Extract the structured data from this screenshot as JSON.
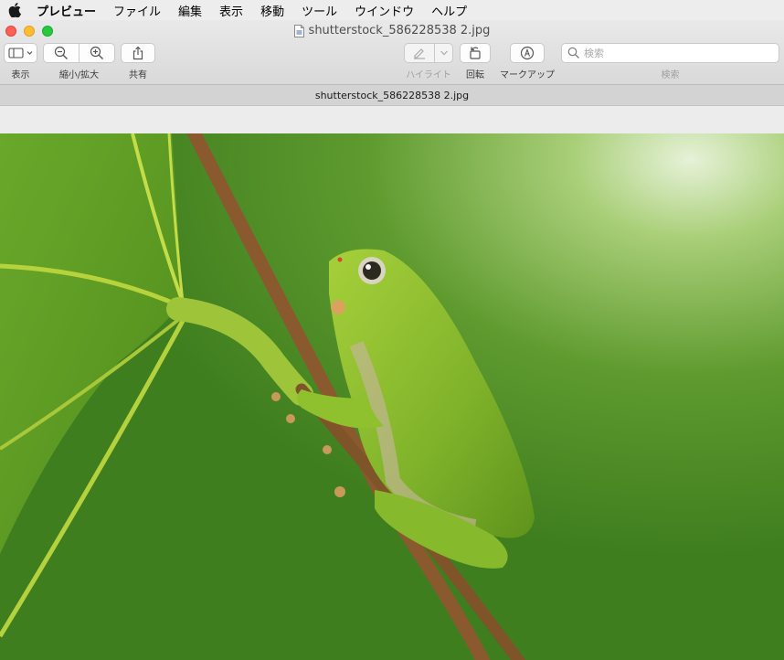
{
  "menubar": {
    "apple_icon": "apple-logo-icon",
    "items": [
      "プレビュー",
      "ファイル",
      "編集",
      "表示",
      "移動",
      "ツール",
      "ウインドウ",
      "ヘルプ"
    ]
  },
  "window": {
    "title": "shutterstock_586228538 2.jpg",
    "tab_title": "shutterstock_586228538 2.jpg"
  },
  "toolbar": {
    "view_label": "表示",
    "zoom_label": "縮小/拡大",
    "share_label": "共有",
    "highlight_label": "ハイライト",
    "rotate_label": "回転",
    "markup_label": "マークアップ",
    "search_label": "検索",
    "search_placeholder": "検索"
  },
  "colors": {
    "close": "#fe5f57",
    "minimize": "#febc2e",
    "zoom": "#28c840"
  },
  "image": {
    "subject": "green tree frog on stem"
  }
}
